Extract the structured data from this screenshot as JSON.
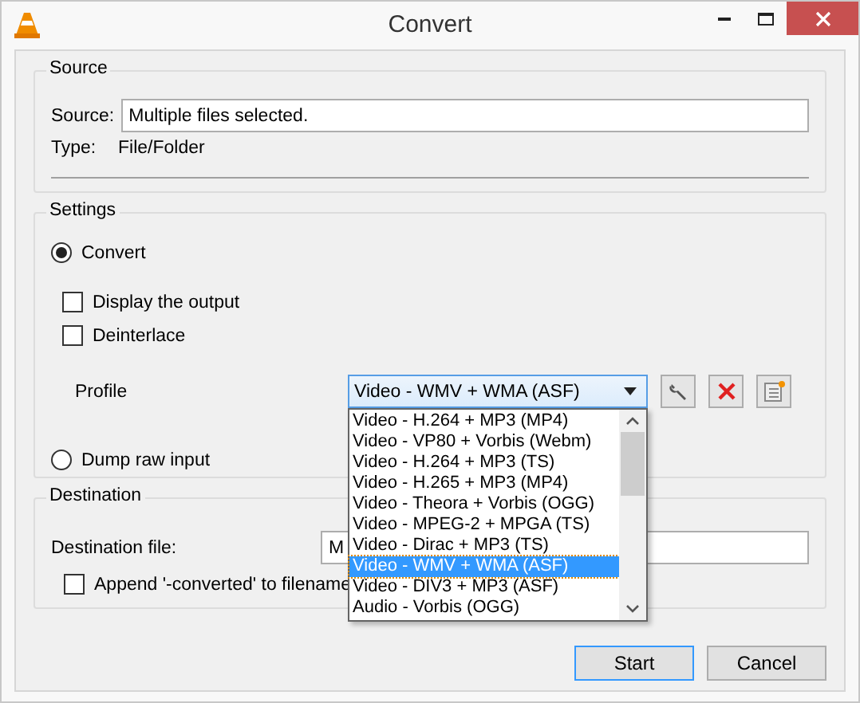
{
  "window": {
    "title": "Convert"
  },
  "source": {
    "title": "Source",
    "label": "Source:",
    "value": "Multiple files selected.",
    "type_label": "Type:",
    "type_value": "File/Folder"
  },
  "settings": {
    "title": "Settings",
    "options": [
      {
        "kind": "radio",
        "label": "Convert",
        "selected": true
      },
      {
        "kind": "checkbox",
        "label": "Display the output",
        "checked": false
      },
      {
        "kind": "checkbox",
        "label": "Deinterlace",
        "checked": false
      }
    ],
    "profile": {
      "label": "Profile",
      "value": "Video - WMV + WMA (ASF)",
      "expanded": true,
      "items": [
        {
          "label": "Video - H.264 + MP3 (MP4)",
          "selected": false
        },
        {
          "label": "Video - VP80 + Vorbis (Webm)",
          "selected": false
        },
        {
          "label": "Video - H.264 + MP3 (TS)",
          "selected": false
        },
        {
          "label": "Video - H.265 + MP3 (MP4)",
          "selected": false
        },
        {
          "label": "Video - Theora + Vorbis (OGG)",
          "selected": false
        },
        {
          "label": "Video - MPEG-2 + MPGA (TS)",
          "selected": false
        },
        {
          "label": "Video - Dirac + MP3 (TS)",
          "selected": false
        },
        {
          "label": "Video - WMV + WMA (ASF)",
          "selected": true
        },
        {
          "label": "Video - DIV3 + MP3 (ASF)",
          "selected": false
        },
        {
          "label": "Audio - Vorbis (OGG)",
          "selected": false
        }
      ]
    },
    "dump": {
      "kind": "radio",
      "label": "Dump raw input",
      "selected": false
    }
  },
  "destination": {
    "title": "Destination",
    "label": "Destination file:",
    "value": "M",
    "append": {
      "label": "Append '-converted' to filename",
      "checked": false
    }
  },
  "buttons": [
    {
      "label": "Start",
      "default": true
    },
    {
      "label": "Cancel",
      "default": false
    }
  ]
}
